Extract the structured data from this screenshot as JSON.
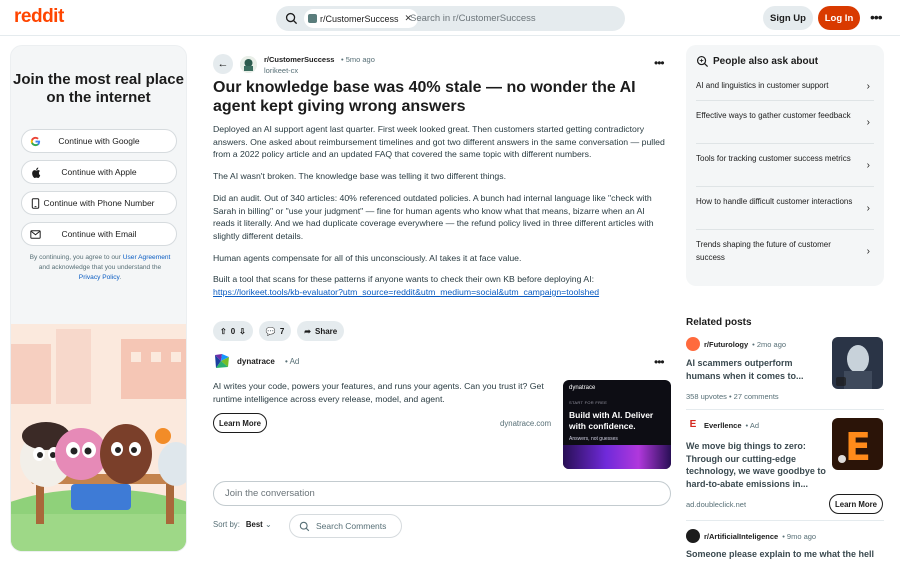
{
  "header": {
    "logo": "reddit",
    "search_chip": "r/CustomerSuccess",
    "search_placeholder": "Search in r/CustomerSuccess",
    "signup": "Sign Up",
    "login": "Log In"
  },
  "join": {
    "title": "Join the most real place on the internet",
    "buttons": [
      {
        "label": "Continue with Google",
        "icon": "google-icon"
      },
      {
        "label": "Continue with Apple",
        "icon": "apple-icon"
      },
      {
        "label": "Continue with Phone Number",
        "icon": "phone-icon"
      },
      {
        "label": "Continue with Email",
        "icon": "email-icon"
      }
    ],
    "terms_pre": "By continuing, you agree to our",
    "terms_link": "User Agreement",
    "terms_mid": "and acknowledge that you understand the",
    "privacy_link": "Privacy Policy",
    "terms_end": "."
  },
  "post": {
    "subreddit": "r/CustomerSuccess",
    "time": "• 5mo ago",
    "author": "lorikeet-cx",
    "title": "Our knowledge base was 40% stale — no wonder the AI agent kept giving wrong answers",
    "paragraphs": [
      "Deployed an AI support agent last quarter. First week looked great. Then customers started getting contradictory answers. One asked about reimbursement timelines and got two different answers in the same conversation — pulled from a 2022 policy article and an updated FAQ that covered the same topic with different numbers.",
      "The AI wasn't broken. The knowledge base was telling it two different things.",
      "Did an audit. Out of 340 articles: 40% referenced outdated policies. A bunch had internal language like \"check with Sarah in billing\" or \"use your judgment\" — fine for human agents who know what that means, bizarre when an AI reads it literally. And we had duplicate coverage everywhere — the refund policy lived in three different articles with slightly different details.",
      "Human agents compensate for all of this unconsciously. AI takes it at face value."
    ],
    "last_para": "Built a tool that scans for these patterns if anyone wants to check their own KB before deploying AI:",
    "link": "https://lorikeet.tools/kb-evaluator?utm_source=reddit&utm_medium=social&utm_campaign=toolshed",
    "votes": "0",
    "comments": "7",
    "share": "Share"
  },
  "ad": {
    "name": "dynatrace",
    "tag": "• Ad",
    "text": "AI writes your code, powers your features, and runs your agents. Can you trust it? Get runtime intelligence across every release, model, and agent.",
    "learn_more": "Learn More",
    "domain": "dynatrace.com",
    "card_brand": "dynatrace",
    "card_start": "START FOR FREE",
    "card_head": "Build with AI. Deliver with confidence.",
    "card_sub": "Answers, not guesses"
  },
  "comments": {
    "placeholder": "Join the conversation",
    "sort_label": "Sort by:",
    "sort_value": "Best",
    "search_placeholder": "Search Comments"
  },
  "people_ask": {
    "title": "People also ask about",
    "items": [
      "AI and linguistics in customer support",
      "Effective ways to gather customer feedback",
      "Tools for tracking customer success metrics",
      "How to handle difficult customer interactions",
      "Trends shaping the future of customer success"
    ]
  },
  "related": {
    "title": "Related posts",
    "posts": [
      {
        "sub": "r/Futurology",
        "time": "• 2mo ago",
        "title": "AI scammers outperform humans when it comes to...",
        "meta": "358 upvotes  •  27 comments"
      },
      {
        "sub": "Everllence",
        "time": "• Ad",
        "title": "We move big things to zero: Through our cutting-edge technology, we wave goodbye to hard-to-abate emissions in...",
        "meta": "ad.doubleclick.net",
        "learn_more": "Learn More"
      },
      {
        "sub": "r/ArtificialInteligence",
        "time": "• 9mo ago",
        "title": "Someone please explain to me what the hell"
      }
    ]
  },
  "colors": {
    "brand": "#ff4500",
    "login": "#d93a00",
    "link": "#0a5cc2"
  }
}
